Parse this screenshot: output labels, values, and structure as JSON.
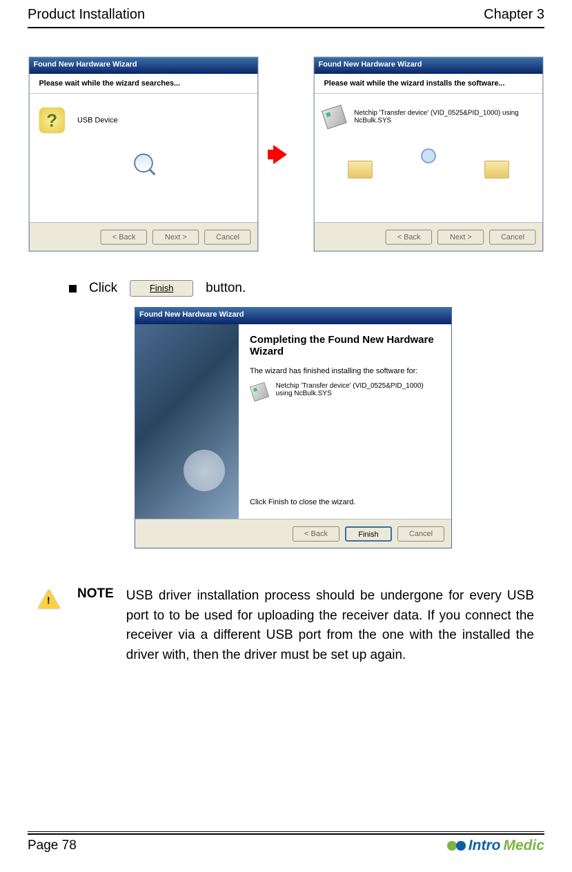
{
  "header": {
    "left": "Product Installation",
    "right": "Chapter 3"
  },
  "wizard1": {
    "title": "Found New Hardware Wizard",
    "subhead": "Please wait while the wizard searches...",
    "device": "USB Device",
    "back": "< Back",
    "next": "Next >",
    "cancel": "Cancel"
  },
  "wizard2": {
    "title": "Found New Hardware Wizard",
    "subhead": "Please wait while the wizard installs the software...",
    "device": "Netchip 'Transfer device' (VID_0525&PID_1000) using NcBulk.SYS",
    "back": "< Back",
    "next": "Next >",
    "cancel": "Cancel"
  },
  "bullet": {
    "click": "Click",
    "finish_btn": "Finish",
    "suffix": "button."
  },
  "wizard3": {
    "title": "Found New Hardware Wizard",
    "heading": "Completing the Found New Hardware Wizard",
    "line1": "The wizard has finished installing the software for:",
    "line2": "Netchip 'Transfer device' (VID_0525&PID_1000) using NcBulk.SYS",
    "line3": "Click Finish to close the wizard.",
    "back": "< Back",
    "finish": "Finish",
    "cancel": "Cancel"
  },
  "note": {
    "label": "NOTE",
    "text": "USB driver installation process should be undergone for every USB port to to be used for uploading the receiver data. If you connect the receiver via a different USB port from the one with the installed the driver with, then the driver must be set up   again."
  },
  "footer": {
    "page": "Page 78",
    "logo1": "Intro",
    "logo2": "Medic"
  }
}
